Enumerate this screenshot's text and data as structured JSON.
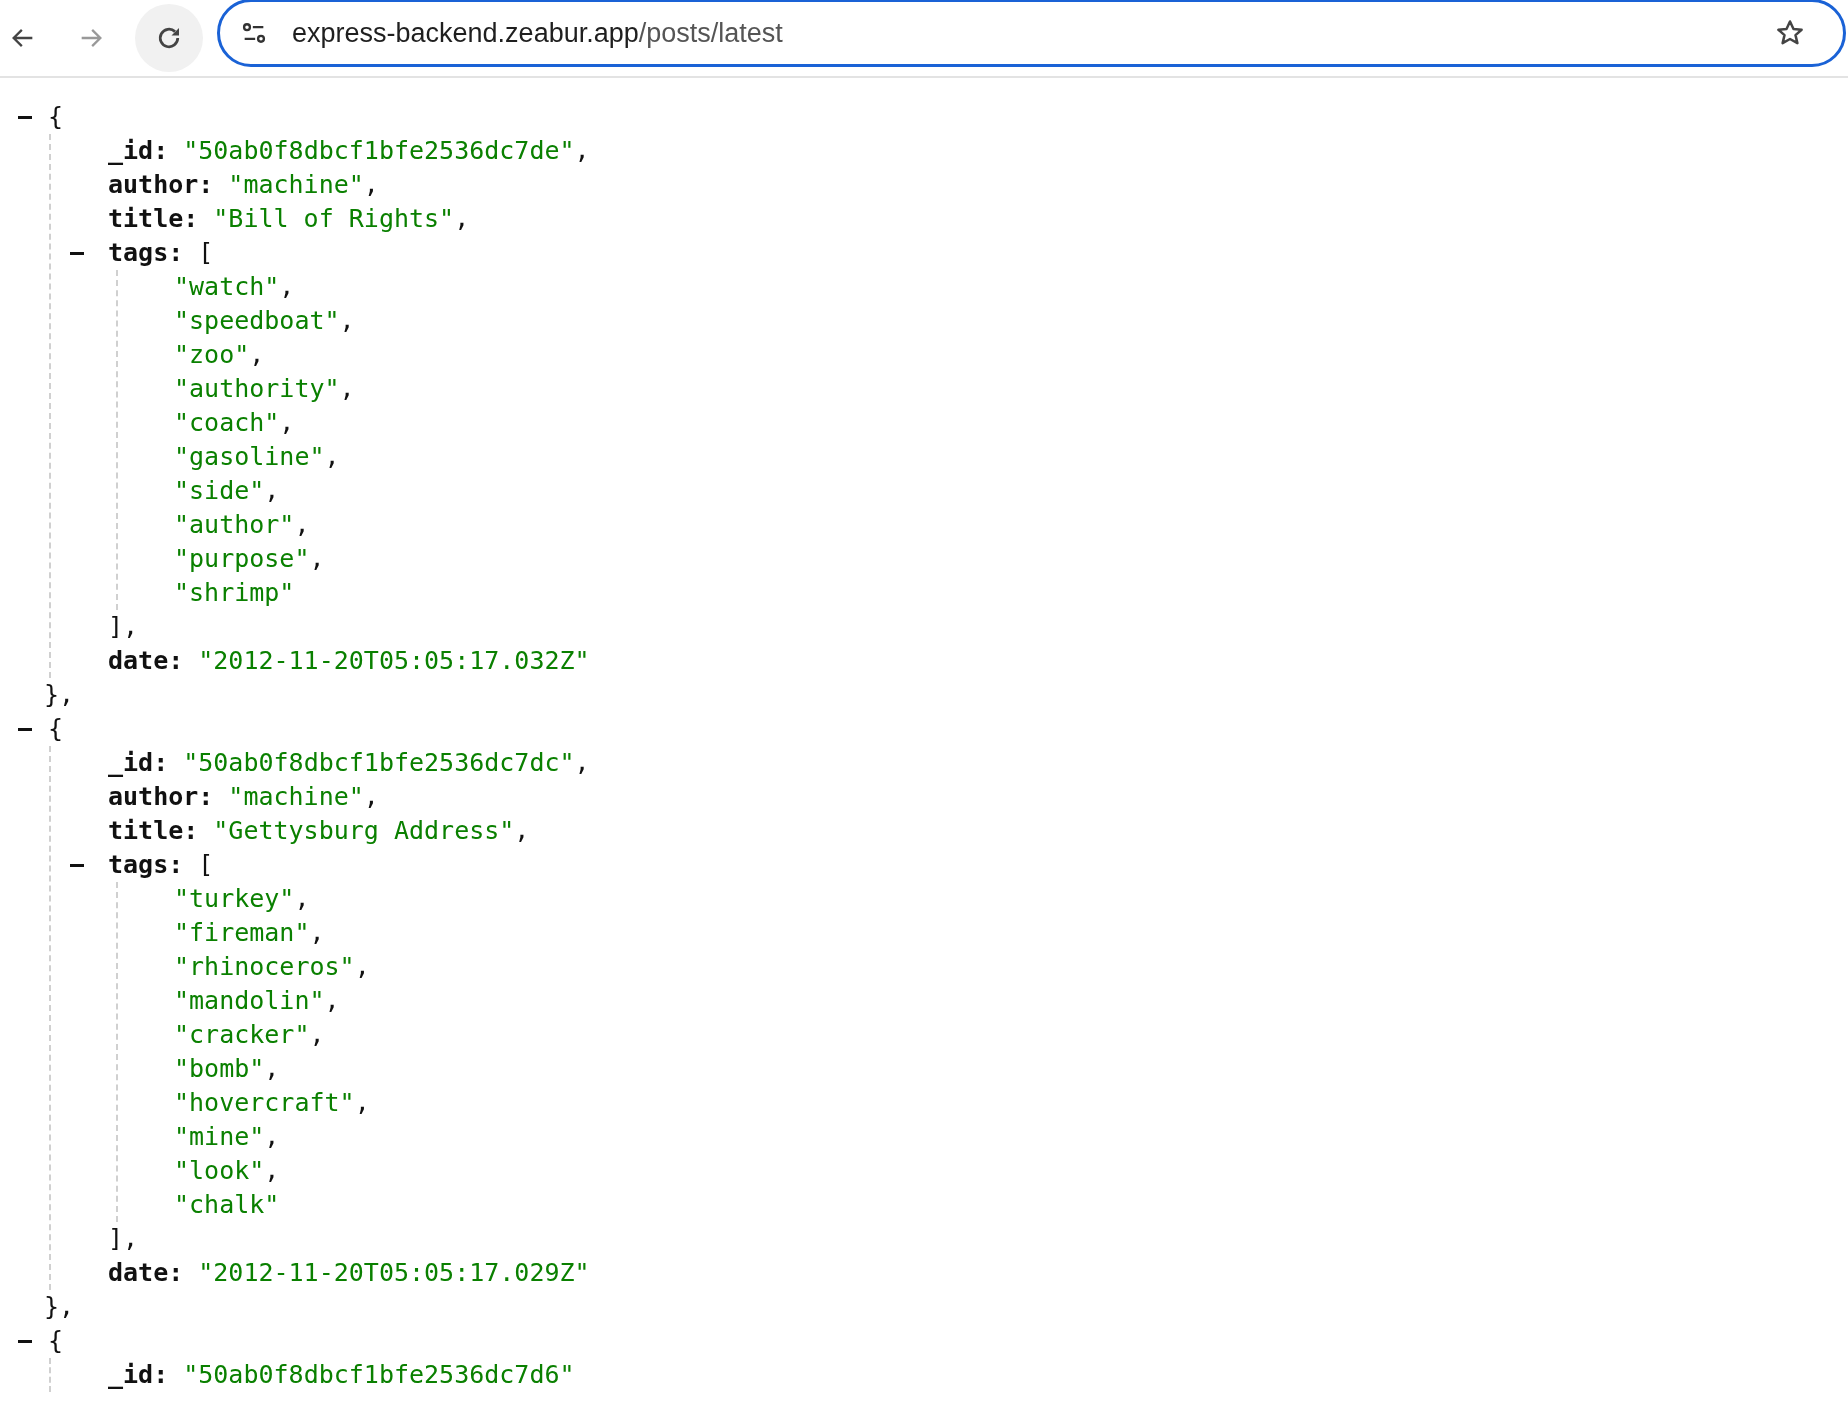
{
  "browser": {
    "url_host": "express-backend.zeabur.app",
    "url_path": "/posts/latest"
  },
  "posts": [
    {
      "expanded": true,
      "open": "{",
      "close": "},",
      "fields": [
        {
          "kind": "string",
          "key": "_id:",
          "value": "\"50ab0f8dbcf1bfe2536dc7de\"",
          "sep": ","
        },
        {
          "kind": "string",
          "key": "author:",
          "value": "\"machine\"",
          "sep": ","
        },
        {
          "kind": "string",
          "key": "title:",
          "value": "\"Bill of Rights\"",
          "sep": ","
        },
        {
          "kind": "array",
          "key": "tags:",
          "open": "[",
          "expanded": true,
          "close": "],",
          "items": [
            {
              "value": "\"watch\"",
              "sep": ","
            },
            {
              "value": "\"speedboat\"",
              "sep": ","
            },
            {
              "value": "\"zoo\"",
              "sep": ","
            },
            {
              "value": "\"authority\"",
              "sep": ","
            },
            {
              "value": "\"coach\"",
              "sep": ","
            },
            {
              "value": "\"gasoline\"",
              "sep": ","
            },
            {
              "value": "\"side\"",
              "sep": ","
            },
            {
              "value": "\"author\"",
              "sep": ","
            },
            {
              "value": "\"purpose\"",
              "sep": ","
            },
            {
              "value": "\"shrimp\""
            }
          ]
        },
        {
          "kind": "string",
          "key": "date:",
          "value": "\"2012-11-20T05:05:17.032Z\""
        }
      ]
    },
    {
      "expanded": true,
      "open": "{",
      "close": "},",
      "fields": [
        {
          "kind": "string",
          "key": "_id:",
          "value": "\"50ab0f8dbcf1bfe2536dc7dc\"",
          "sep": ","
        },
        {
          "kind": "string",
          "key": "author:",
          "value": "\"machine\"",
          "sep": ","
        },
        {
          "kind": "string",
          "key": "title:",
          "value": "\"Gettysburg Address\"",
          "sep": ","
        },
        {
          "kind": "array",
          "key": "tags:",
          "open": "[",
          "expanded": true,
          "close": "],",
          "items": [
            {
              "value": "\"turkey\"",
              "sep": ","
            },
            {
              "value": "\"fireman\"",
              "sep": ","
            },
            {
              "value": "\"rhinoceros\"",
              "sep": ","
            },
            {
              "value": "\"mandolin\"",
              "sep": ","
            },
            {
              "value": "\"cracker\"",
              "sep": ","
            },
            {
              "value": "\"bomb\"",
              "sep": ","
            },
            {
              "value": "\"hovercraft\"",
              "sep": ","
            },
            {
              "value": "\"mine\"",
              "sep": ","
            },
            {
              "value": "\"look\"",
              "sep": ","
            },
            {
              "value": "\"chalk\""
            }
          ]
        },
        {
          "kind": "string",
          "key": "date:",
          "value": "\"2012-11-20T05:05:17.029Z\""
        }
      ]
    },
    {
      "expanded": true,
      "open": "{",
      "fields": [
        {
          "kind": "string",
          "key": "_id:",
          "value": "\"50ab0f8dbcf1bfe2536dc7d6\""
        }
      ]
    }
  ]
}
